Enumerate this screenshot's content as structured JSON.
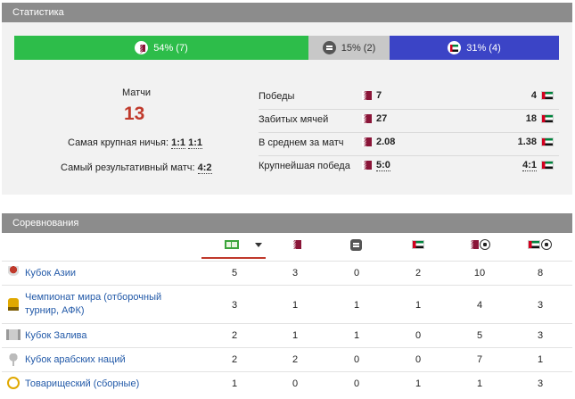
{
  "stats": {
    "header": "Статистика",
    "distribution": {
      "win": "54% (7)",
      "draw": "15% (2)",
      "loss": "31% (4)"
    },
    "matches_label": "Матчи",
    "matches_value": "13",
    "biggest_draw_label": "Самая крупная ничья:",
    "biggest_draw_value1": "1:1",
    "biggest_draw_value2": "1:1",
    "highest_scoring_label": "Самый результативный матч:",
    "highest_scoring_value": "4:2",
    "rows": [
      {
        "label": "Победы",
        "a": "7",
        "b": "4"
      },
      {
        "label": "Забитых мячей",
        "a": "27",
        "b": "18"
      },
      {
        "label": "В среднем за матч",
        "a": "2.08",
        "b": "1.38"
      },
      {
        "label": "Крупнейшая победа",
        "a": "5:0",
        "b": "4:1"
      }
    ]
  },
  "competitions": {
    "header": "Соревнования",
    "rows": [
      {
        "name": "Кубок Азии",
        "v": [
          "5",
          "3",
          "0",
          "2",
          "10",
          "8"
        ]
      },
      {
        "name_line1": "Чемпионат мира (отборочный",
        "name_line2": "турнир, АФК)",
        "v": [
          "3",
          "1",
          "1",
          "1",
          "4",
          "3"
        ]
      },
      {
        "name": "Кубок Залива",
        "v": [
          "2",
          "1",
          "1",
          "0",
          "5",
          "3"
        ]
      },
      {
        "name": "Кубок арабских наций",
        "v": [
          "2",
          "2",
          "0",
          "0",
          "7",
          "1"
        ]
      },
      {
        "name": "Товарищеский (сборные)",
        "v": [
          "1",
          "0",
          "0",
          "1",
          "1",
          "3"
        ]
      }
    ]
  },
  "colors": {
    "win": "#2dbd4a",
    "draw": "#c8c8c8",
    "loss": "#3b44c6",
    "accent": "#c0392b",
    "link": "#2259a8"
  },
  "icons": [
    "qatar-flag-icon",
    "uae-flag-icon",
    "draw-equals-icon",
    "football-ball-icon",
    "trophy-icon",
    "field-icon",
    "sort-desc-icon"
  ]
}
